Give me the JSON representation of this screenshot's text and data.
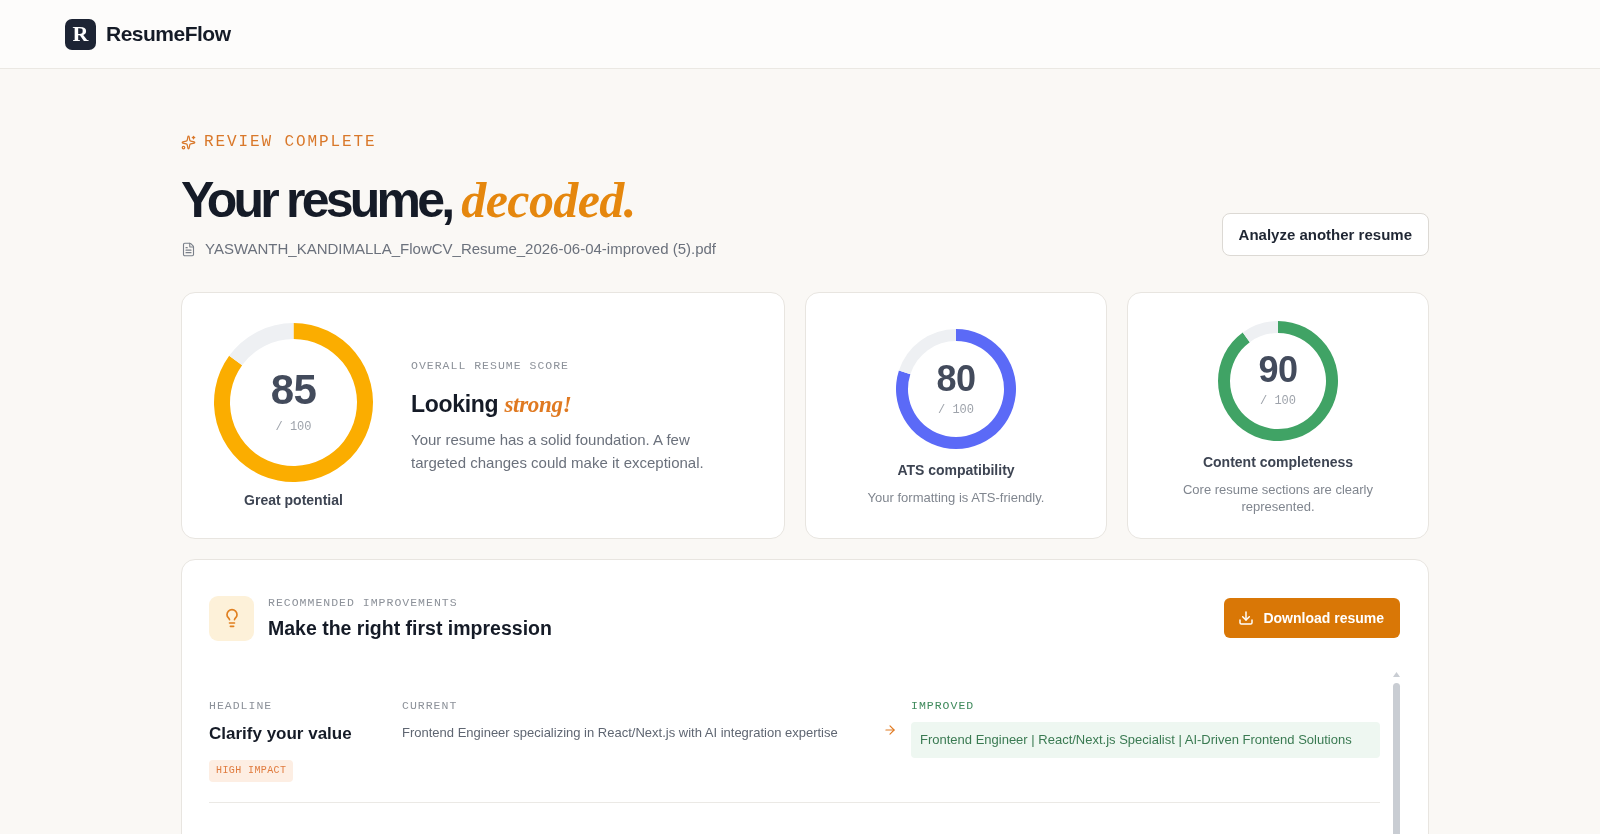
{
  "header": {
    "logo_letter": "R",
    "brand": "ResumeFlow"
  },
  "hero": {
    "eyebrow": "REVIEW COMPLETE",
    "title": "Your resume, *decoded.*",
    "file_name": "YASWANTH_KANDIMALLA_FlowCV_Resume_2026-06-04-improved (5).pdf",
    "action_button": "Analyze another resume"
  },
  "scores": [
    {
      "kind": "overall",
      "value": "85",
      "max": "/ 100",
      "chart_data": {
        "type": "donut",
        "values": [
          85,
          15
        ],
        "colors": [
          "#fbad00",
          "#eef0f3"
        ]
      },
      "caption": "Great potential",
      "label": "OVERALL RESUME SCORE",
      "headline": "Looking *strong!*",
      "description": "Your resume has a solid foundation. A few targeted changes could make it exceptional."
    },
    {
      "kind": "metric",
      "value": "80",
      "max": "/ 100",
      "chart_data": {
        "type": "donut",
        "values": [
          80,
          20
        ],
        "colors": [
          "#5b6af7",
          "#eef0f3"
        ]
      },
      "title": "ATS compatibility",
      "description": "Your formatting is ATS-friendly."
    },
    {
      "kind": "metric",
      "value": "90",
      "max": "/ 100",
      "chart_data": {
        "type": "donut",
        "values": [
          90,
          10
        ],
        "colors": [
          "#40a365",
          "#eef0f3"
        ]
      },
      "title": "Content completeness",
      "description": "Core resume sections are clearly represented."
    }
  ],
  "recommendations": {
    "label": "RECOMMENDED IMPROVEMENTS",
    "title": "Make the right first impression",
    "download_button": "Download resume",
    "items": [
      {
        "category": "HEADLINE",
        "title": "Clarify your value",
        "impact": "HIGH IMPACT",
        "current_label": "CURRENT",
        "current": "Frontend Engineer specializing in React/Next.js with AI integration expertise",
        "improved_label": "IMPROVED",
        "improved": "Frontend Engineer | React/Next.js Specialist | AI-Driven Frontend Solutions"
      }
    ]
  }
}
